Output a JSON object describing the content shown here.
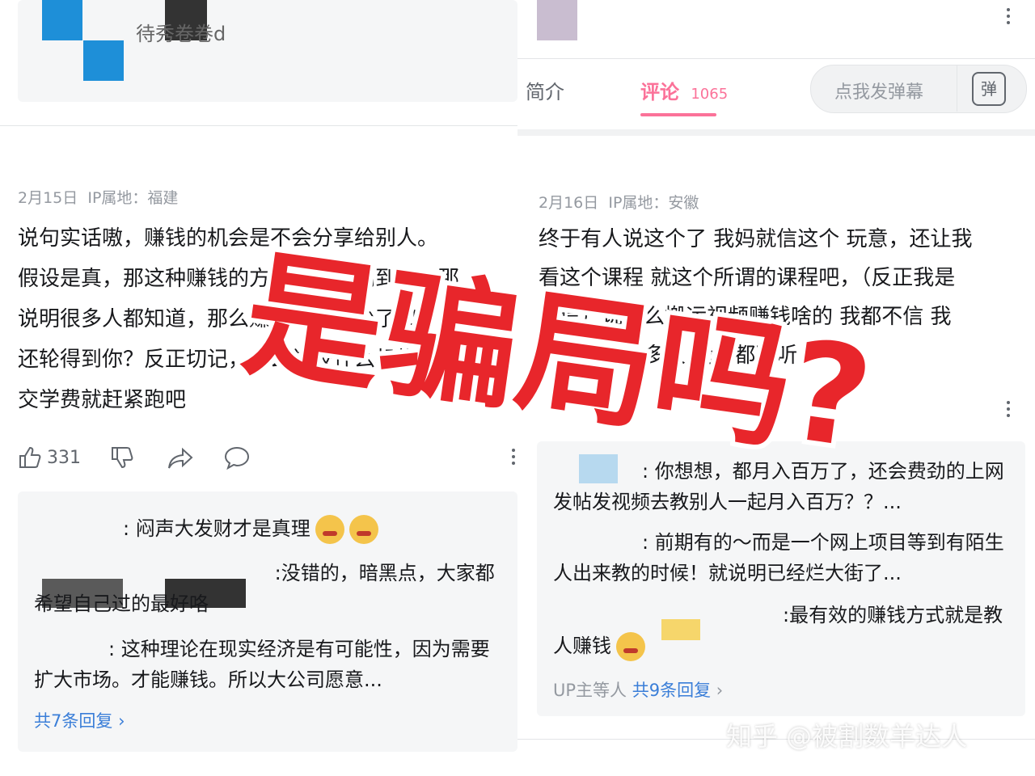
{
  "left": {
    "header_name": "待秀卷卷d",
    "comment": {
      "date": "2月15日",
      "ip": "IP属地：福建",
      "text": "说句实话嗷，赚钱的机会是不会分享给别人。\n假设是真，那这种赚钱的方法我都能刷到了，那\n说明很多人都知道，那么赚钱的也就少了和，那\n还轮得到你？反正切记，什么学校什么机构要\n交学费就赶紧跑吧",
      "like_count": "331"
    },
    "replies": [
      {
        "text": ": 闷声大发财才是真理"
      },
      {
        "text": " :没错的，暗黑点，大家都希望自己过的最好咯"
      },
      {
        "text": ": 这种理论在现实经济是有可能性，因为需要扩大市场。才能赚钱。所以大公司愿意..."
      }
    ],
    "more_replies": "共7条回复"
  },
  "right": {
    "tabs": {
      "intro": "简介",
      "comments": "评论",
      "comment_count": "1065",
      "danmaku_placeholder": "点我发弹幕",
      "danmaku_icon_char": "弹"
    },
    "comment": {
      "date": "2月16日",
      "ip": "IP属地：安徽",
      "text": "终于有人说这个了 我妈就信这个 玩意，还让我\n看这个课程 就这个所谓的课程吧，（反正我是\n不信）说什么搬运视频赚钱啥的 我都不信 我\n跟她说了好多次 我妈都不听"
    },
    "replies": [
      {
        "text": ": 你想想，都月入百万了，还会费劲的上网发帖发视频去教别人一起月入百万？？..."
      },
      {
        "text": ": 前期有的～而是一个网上项目等到有陌生人出来教的时候！就说明已经烂大街了..."
      },
      {
        "text": ":最有效的赚钱方式就是教人赚钱"
      }
    ],
    "more_prefix": "UP主等人",
    "more_replies": "共9条回复"
  },
  "overlay_title": "是骗局吗?",
  "watermark": "知乎 @被割数羊达人",
  "colors": {
    "accent_pink": "#fb7299",
    "link_blue": "#3a7ed8",
    "overlay_red": "#e8262b"
  }
}
